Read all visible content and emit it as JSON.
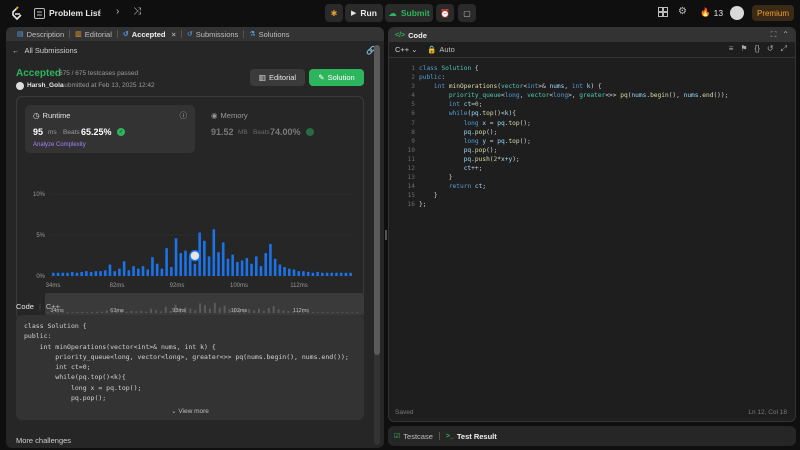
{
  "topbar": {
    "problem_list": "Problem List",
    "run_label": "Run",
    "submit_label": "Submit",
    "streak_count": "13",
    "premium_label": "Premium"
  },
  "left": {
    "tabs": [
      {
        "label": "Description",
        "icon": "document-icon"
      },
      {
        "label": "Editorial",
        "icon": "book-icon"
      },
      {
        "label": "Accepted",
        "icon": "history-icon"
      },
      {
        "label": "Submissions",
        "icon": "history-icon"
      },
      {
        "label": "Solutions",
        "icon": "flask-icon"
      }
    ],
    "back_label": "All Submissions",
    "status": "Accepted",
    "passed": "675 / 675 testcases passed",
    "username": "Harsh_Gola",
    "submitted_at": "submitted at Feb 13, 2025 12:42",
    "editorial_btn": "Editorial",
    "solution_btn": "Solution",
    "runtime": {
      "title": "Runtime",
      "value": "95",
      "unit": "ms",
      "beats_label": "Beats",
      "beats": "65.25%",
      "analyze": "Analyze Complexity"
    },
    "memory": {
      "title": "Memory",
      "value": "91.52",
      "unit": "MB",
      "beats_label": "Beats",
      "beats": "74.00%"
    },
    "code_header": "Code",
    "code_lang": "C++",
    "code_snippet": "class Solution {\npublic:\n    int minOperations(vector<int>& nums, int k) {\n        priority_queue<long, vector<long>, greater<>> pq(nums.begin(), nums.end());\n        int ct=0;\n        while(pq.top()<k){\n            long x = pq.top();\n            pq.pop();",
    "view_more": "View more",
    "more_challenges": "More challenges"
  },
  "right": {
    "title": "Code",
    "lang": "C++",
    "auto": "Auto",
    "line_numbers": "1\n2\n3\n4\n5\n6\n7\n8\n9\n10\n11\n12\n13\n14\n15\n16",
    "saved": "Saved",
    "cursor": "Ln 12, Col 18"
  },
  "bottom": {
    "testcase": "Testcase",
    "test_result": "Test Result"
  },
  "colors": {
    "accent_green": "#2db55d",
    "bar_blue": "#1a73e8",
    "premium_orange": "#f0a030"
  },
  "chart_data": {
    "type": "bar",
    "ylabel_ticks": [
      "10%",
      "5%",
      "0%"
    ],
    "ylim": [
      0,
      10
    ],
    "x_ticks": [
      "34ms",
      "82ms",
      "92ms",
      "100ms",
      "112ms"
    ],
    "mini_ticks": [
      "34ms",
      "63ms",
      "93ms",
      "102ms",
      "112ms"
    ],
    "values": [
      0.4,
      0.4,
      0.4,
      0.4,
      0.5,
      0.4,
      0.5,
      0.6,
      0.5,
      0.6,
      0.6,
      0.7,
      1.4,
      0.6,
      0.9,
      1.8,
      0.7,
      1.2,
      0.9,
      1.2,
      0.8,
      2.3,
      1.5,
      0.9,
      3.4,
      1.1,
      4.6,
      2.8,
      3.1,
      2.5,
      1.5,
      5.3,
      4.3,
      2.4,
      5.7,
      2.9,
      4.1,
      2.1,
      2.6,
      1.7,
      1.9,
      2.2,
      1.5,
      2.4,
      1.2,
      2.8,
      3.9,
      2.1,
      1.4,
      1.1,
      0.9,
      0.8,
      0.6,
      0.6,
      0.5,
      0.4,
      0.5,
      0.4,
      0.4,
      0.4,
      0.4,
      0.4,
      0.4,
      0.4
    ],
    "highlight_index": 30
  }
}
